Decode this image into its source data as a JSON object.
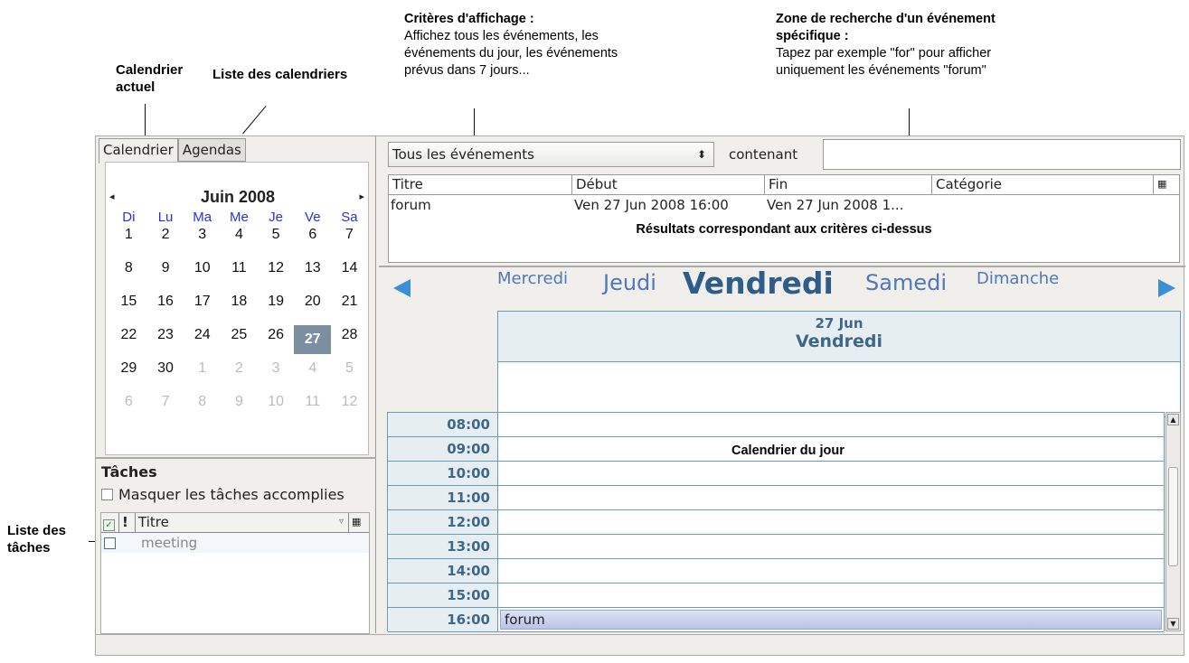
{
  "annotations": {
    "current_calendar": [
      "Calendrier",
      "actuel"
    ],
    "calendar_list": "Liste des calendriers",
    "criteria_title": "Critères d'affichage :",
    "criteria_text": [
      "Affichez tous les événements, les",
      "événements du jour, les événements",
      "prévus dans 7 jours..."
    ],
    "search_title": [
      "Zone de recherche d'un événement",
      "spécifique :"
    ],
    "search_text": [
      "Tapez par exemple \"for\" pour afficher",
      "uniquement les événements \"forum\""
    ],
    "task_list": [
      "Liste des",
      "tâches"
    ]
  },
  "tabs": [
    "Calendrier",
    "Agendas"
  ],
  "minical": {
    "month_label": "Juin  2008",
    "prev_icon": "◂",
    "next_icon": "▸",
    "weekdays": [
      "Di",
      "Lu",
      "Ma",
      "Me",
      "Je",
      "Ve",
      "Sa"
    ],
    "weeks": [
      [
        "1",
        "2",
        "3",
        "4",
        "5",
        "6",
        "7"
      ],
      [
        "8",
        "9",
        "10",
        "11",
        "12",
        "13",
        "14"
      ],
      [
        "15",
        "16",
        "17",
        "18",
        "19",
        "20",
        "21"
      ],
      [
        "22",
        "23",
        "24",
        "25",
        "26",
        "27",
        "28"
      ],
      [
        "29",
        "30",
        "1",
        "2",
        "3",
        "4",
        "5"
      ],
      [
        "6",
        "7",
        "8",
        "9",
        "10",
        "11",
        "12"
      ]
    ],
    "selected_day": "27"
  },
  "tasks": {
    "title": "Tâches",
    "hide_completed": "Masquer les tâches accomplies",
    "columns": [
      "!",
      "Titre"
    ],
    "items": [
      {
        "title": "meeting"
      }
    ]
  },
  "filter": {
    "selected": "Tous les événements",
    "spinner_icon": "⬍",
    "containing_label": "contenant",
    "search_value": ""
  },
  "event_table": {
    "columns": [
      "Titre",
      "Début",
      "Fin",
      "Catégorie"
    ],
    "rows": [
      [
        "forum",
        "Ven 27 Jun 2008 16:00",
        "Ven 27 Jun 2008 1...",
        ""
      ]
    ],
    "note": "Résultats correspondant aux critères ci-dessus"
  },
  "day_nav": {
    "days": [
      "Mercredi",
      "Jeudi",
      "Vendredi",
      "Samedi",
      "Dimanche"
    ],
    "current_date": "27 Jun",
    "current_day": "Vendredi"
  },
  "day_view": {
    "hours": [
      "08:00",
      "09:00",
      "10:00",
      "11:00",
      "12:00",
      "13:00",
      "14:00",
      "15:00",
      "16:00"
    ],
    "note": "Calendrier du jour",
    "events": [
      {
        "hour": "16:00",
        "title": "forum"
      }
    ]
  },
  "colors": {
    "accent": "#5077b8",
    "nav_arrow": "#3b8fd8",
    "selected_day": "#7b8fa0",
    "weekday": "#2233dd"
  }
}
